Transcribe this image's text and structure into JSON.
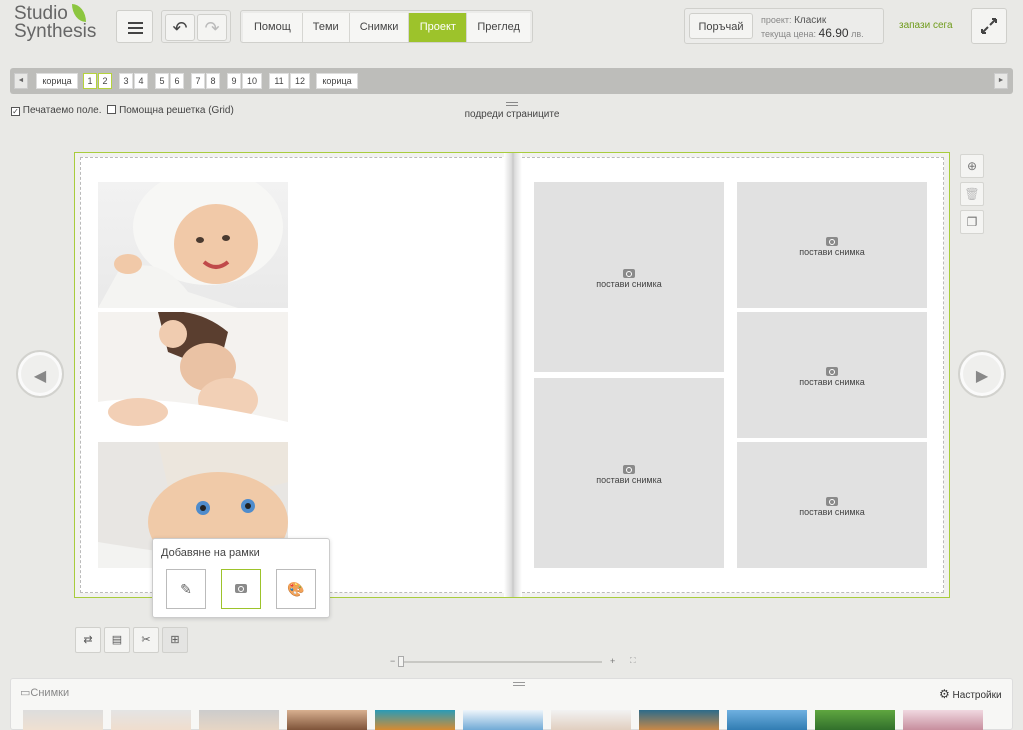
{
  "app": {
    "logo_line1": "Studio",
    "logo_line2": "Synthesis"
  },
  "toolbar": {
    "tabs": [
      {
        "label": "Помощ",
        "active": false
      },
      {
        "label": "Теми",
        "active": false
      },
      {
        "label": "Снимки",
        "active": false
      },
      {
        "label": "Проект",
        "active": true
      },
      {
        "label": "Преглед",
        "active": false
      }
    ],
    "order_label": "Поръчай",
    "project_caption": "проект:",
    "project_name": "Класик",
    "price_caption": "текуща цена:",
    "price_value": "46.90",
    "price_unit": "лв.",
    "save_now": "запази сега"
  },
  "page_bar": {
    "buttons": [
      "корица",
      "1",
      "2",
      "3",
      "4",
      "5",
      "6",
      "7",
      "8",
      "9",
      "10",
      "11",
      "12",
      "корица"
    ],
    "selected": [
      "1",
      "2"
    ]
  },
  "options": {
    "printable_area": "Печатаемо поле.",
    "printable_checked": true,
    "grid": "Помощна решетка (Grid)",
    "grid_checked": false,
    "arrange_pages": "подреди страниците"
  },
  "placeholder_label": "постави снимка",
  "popup": {
    "title": "Добавяне на рамки"
  },
  "tray": {
    "title": "Снимки",
    "settings": "Настройки"
  },
  "colors": {
    "accent": "#9dc32b",
    "leaf": "#8cc63f",
    "save_link": "#6f9b1a"
  }
}
